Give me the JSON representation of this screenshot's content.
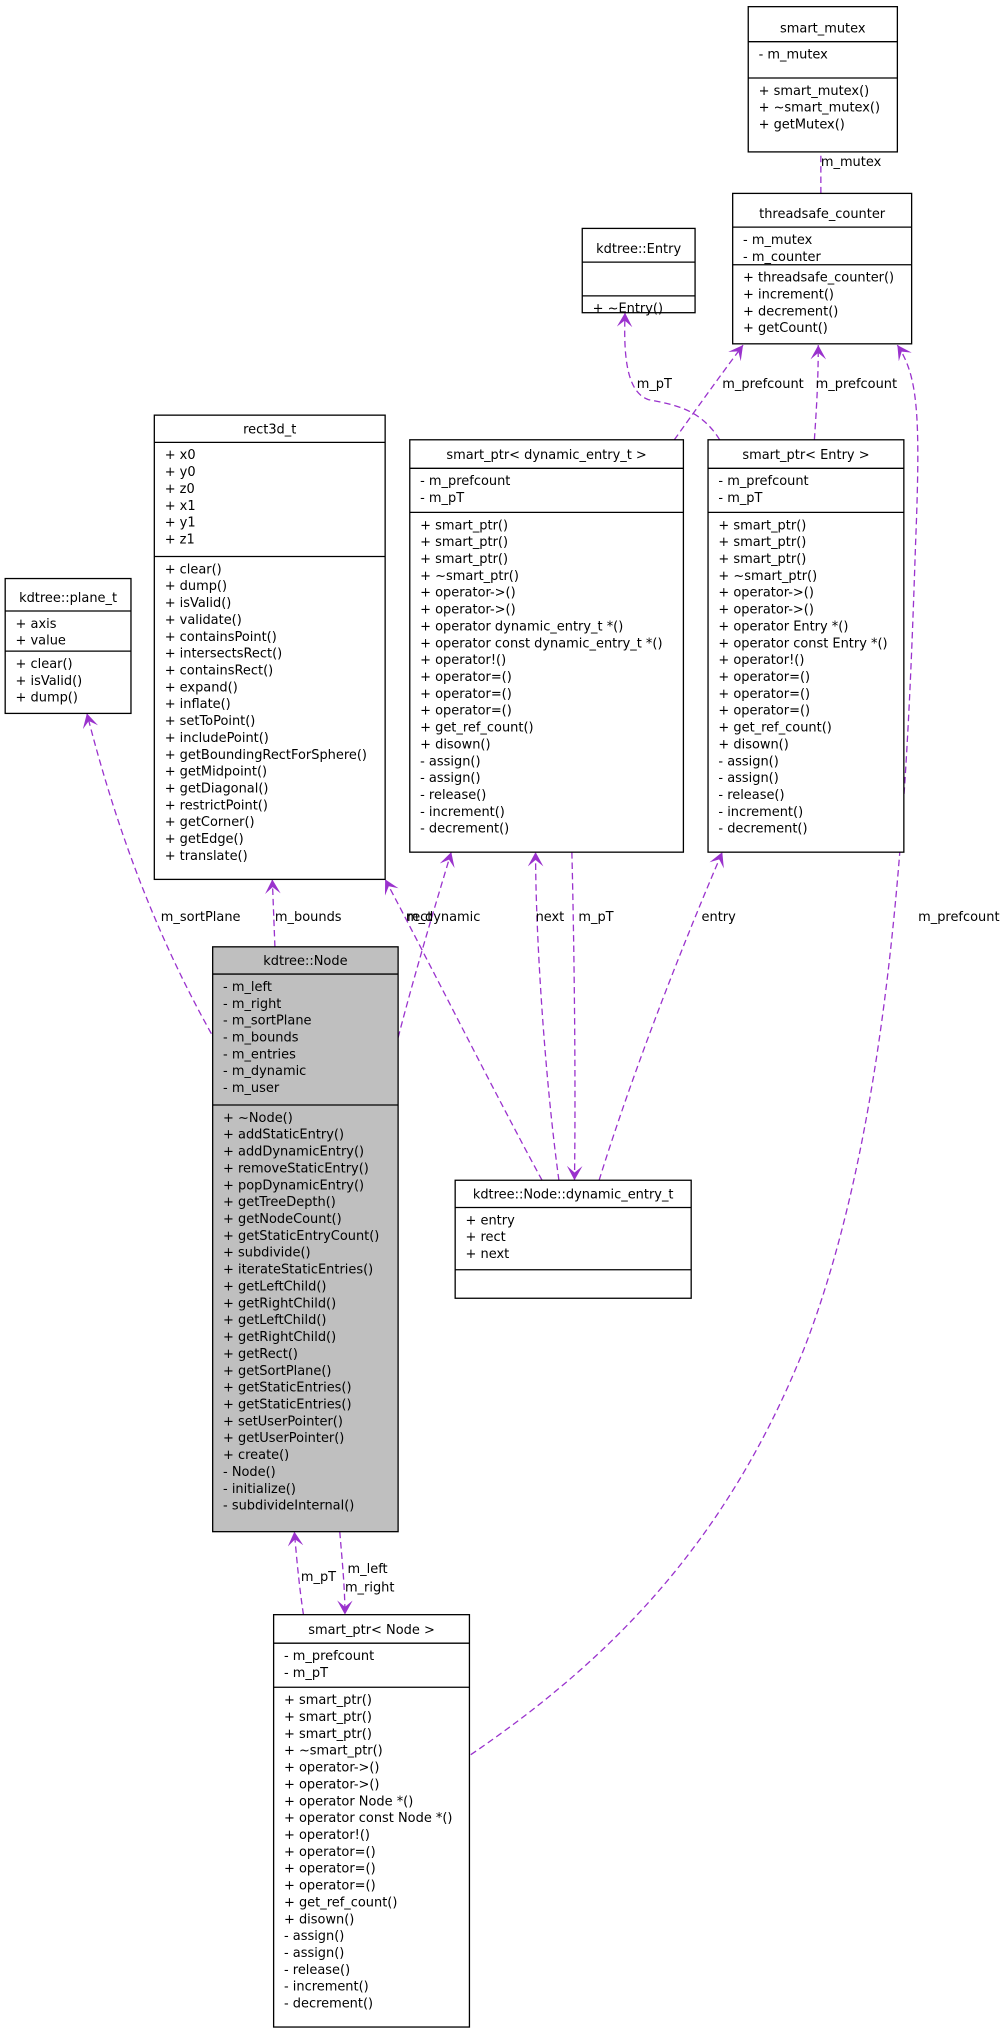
{
  "colors": {
    "edge": "#9a32cd",
    "focus_fill": "#bfbfbf",
    "box_fill": "#ffffff",
    "border": "#000000"
  },
  "classes": [
    {
      "id": "smart_mutex",
      "name": "smart_mutex",
      "attributes": [
        "- m_mutex"
      ],
      "methods": [
        "+ smart_mutex()",
        "+ ~smart_mutex()",
        "+ getMutex()"
      ]
    },
    {
      "id": "threadsafe_counter",
      "name": "threadsafe_counter",
      "attributes": [
        "- m_mutex",
        "- m_counter"
      ],
      "methods": [
        "+ threadsafe_counter()",
        "+ increment()",
        "+ decrement()",
        "+ getCount()"
      ]
    },
    {
      "id": "entry",
      "name": "kdtree::Entry",
      "attributes": [],
      "methods": [
        "+ ~Entry()"
      ]
    },
    {
      "id": "rect3d",
      "name": "rect3d_t",
      "attributes": [
        "+ x0",
        "+ y0",
        "+ z0",
        "+ x1",
        "+ y1",
        "+ z1"
      ],
      "methods": [
        "+ clear()",
        "+ dump()",
        "+ isValid()",
        "+ validate()",
        "+ containsPoint()",
        "+ intersectsRect()",
        "+ containsRect()",
        "+ expand()",
        "+ inflate()",
        "+ setToPoint()",
        "+ includePoint()",
        "+ getBoundingRectForSphere()",
        "+ getMidpoint()",
        "+ getDiagonal()",
        "+ restrictPoint()",
        "+ getCorner()",
        "+ getEdge()",
        "+ translate()"
      ]
    },
    {
      "id": "plane",
      "name": "kdtree::plane_t",
      "attributes": [
        "+ axis",
        "+ value"
      ],
      "methods": [
        "+ clear()",
        "+ isValid()",
        "+ dump()"
      ]
    },
    {
      "id": "sp_dyn",
      "name": "smart_ptr< dynamic_entry_t >",
      "attributes": [
        "- m_prefcount",
        "- m_pT"
      ],
      "methods": [
        "+ smart_ptr()",
        "+ smart_ptr()",
        "+ smart_ptr()",
        "+ ~smart_ptr()",
        "+ operator->()",
        "+ operator->()",
        "+ operator dynamic_entry_t *()",
        "+ operator const dynamic_entry_t *()",
        "+ operator!()",
        "+ operator=()",
        "+ operator=()",
        "+ operator=()",
        "+ get_ref_count()",
        "+ disown()",
        "- assign()",
        "- assign()",
        "- release()",
        "- increment()",
        "- decrement()"
      ]
    },
    {
      "id": "sp_entry",
      "name": "smart_ptr< Entry >",
      "attributes": [
        "- m_prefcount",
        "- m_pT"
      ],
      "methods": [
        "+ smart_ptr()",
        "+ smart_ptr()",
        "+ smart_ptr()",
        "+ ~smart_ptr()",
        "+ operator->()",
        "+ operator->()",
        "+ operator Entry *()",
        "+ operator const Entry *()",
        "+ operator!()",
        "+ operator=()",
        "+ operator=()",
        "+ operator=()",
        "+ get_ref_count()",
        "+ disown()",
        "- assign()",
        "- assign()",
        "- release()",
        "- increment()",
        "- decrement()"
      ]
    },
    {
      "id": "node",
      "name": "kdtree::Node",
      "focus": true,
      "attributes": [
        "- m_left",
        "- m_right",
        "- m_sortPlane",
        "- m_bounds",
        "- m_entries",
        "- m_dynamic",
        "- m_user"
      ],
      "methods": [
        "+ ~Node()",
        "+ addStaticEntry()",
        "+ addDynamicEntry()",
        "+ removeStaticEntry()",
        "+ popDynamicEntry()",
        "+ getTreeDepth()",
        "+ getNodeCount()",
        "+ getStaticEntryCount()",
        "+ subdivide()",
        "+ iterateStaticEntries()",
        "+ getLeftChild()",
        "+ getRightChild()",
        "+ getLeftChild()",
        "+ getRightChild()",
        "+ getRect()",
        "+ getSortPlane()",
        "+ getStaticEntries()",
        "+ getStaticEntries()",
        "+ setUserPointer()",
        "+ getUserPointer()",
        "+ create()",
        "- Node()",
        "- initialize()",
        "- subdivideInternal()"
      ]
    },
    {
      "id": "dyn_entry",
      "name": "kdtree::Node::dynamic_entry_t",
      "attributes": [
        "+ entry",
        "+ rect",
        "+ next"
      ],
      "methods": []
    },
    {
      "id": "sp_node",
      "name": "smart_ptr< Node >",
      "attributes": [
        "- m_prefcount",
        "- m_pT"
      ],
      "methods": [
        "+ smart_ptr()",
        "+ smart_ptr()",
        "+ smart_ptr()",
        "+ ~smart_ptr()",
        "+ operator->()",
        "+ operator->()",
        "+ operator Node *()",
        "+ operator const Node *()",
        "+ operator!()",
        "+ operator=()",
        "+ operator=()",
        "+ operator=()",
        "+ get_ref_count()",
        "+ disown()",
        "- assign()",
        "- assign()",
        "- release()",
        "- increment()",
        "- decrement()"
      ]
    }
  ],
  "edges": [
    {
      "from": "threadsafe_counter",
      "to": "smart_mutex",
      "labels": [
        "m_mutex"
      ]
    },
    {
      "from": "sp_dyn",
      "to": "threadsafe_counter",
      "labels": [
        "m_prefcount"
      ]
    },
    {
      "from": "sp_entry",
      "to": "threadsafe_counter",
      "labels": [
        "m_prefcount"
      ]
    },
    {
      "from": "sp_entry",
      "to": "entry",
      "labels": [
        "m_pT"
      ]
    },
    {
      "from": "sp_node",
      "to": "threadsafe_counter",
      "labels": [
        "m_prefcount"
      ]
    },
    {
      "from": "node",
      "to": "plane",
      "labels": [
        "m_sortPlane"
      ]
    },
    {
      "from": "node",
      "to": "rect3d",
      "labels": [
        "m_bounds"
      ]
    },
    {
      "from": "node",
      "to": "sp_dyn",
      "labels": [
        "m_dynamic"
      ]
    },
    {
      "from": "dyn_entry",
      "to": "rect3d",
      "labels": [
        "rect"
      ]
    },
    {
      "from": "dyn_entry",
      "to": "sp_dyn",
      "labels": [
        "next"
      ]
    },
    {
      "from": "sp_dyn",
      "to": "dyn_entry",
      "labels": [
        "m_pT"
      ]
    },
    {
      "from": "dyn_entry",
      "to": "sp_entry",
      "labels": [
        "entry"
      ]
    },
    {
      "from": "sp_node",
      "to": "node",
      "labels": [
        "m_pT"
      ]
    },
    {
      "from": "node",
      "to": "sp_node",
      "labels": [
        "m_left",
        "m_right"
      ]
    }
  ]
}
